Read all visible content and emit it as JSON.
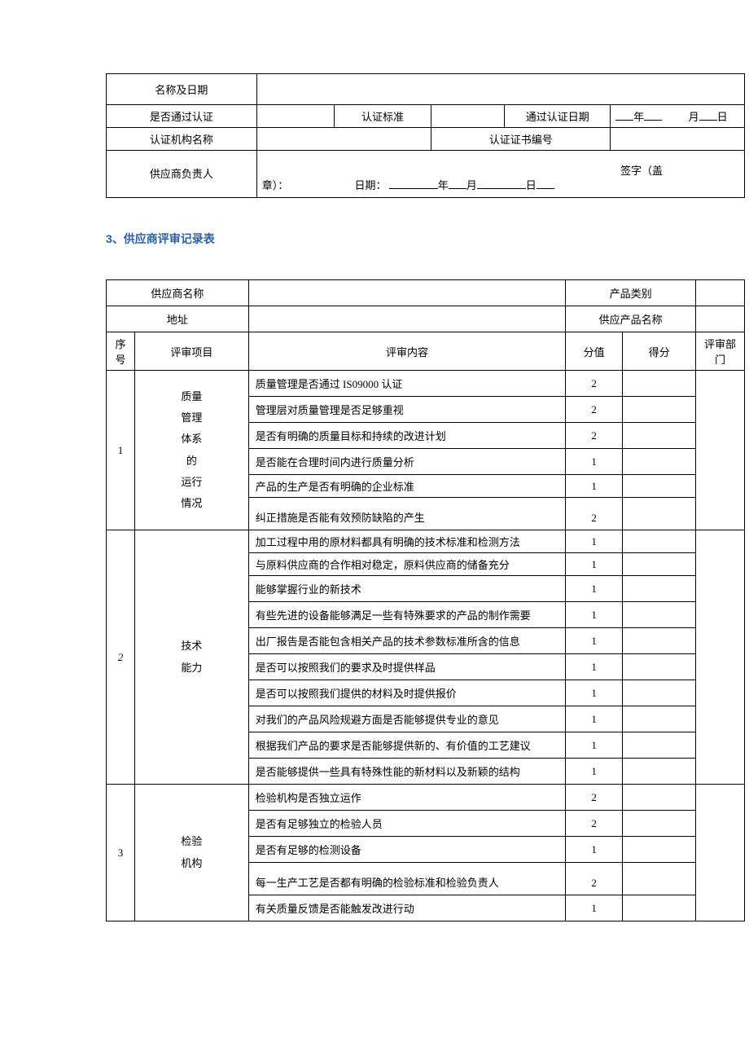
{
  "top": {
    "row1_label": "名称及日期",
    "cert_pass": "是否通过认证",
    "cert_std": "认证标准",
    "cert_date_label": "通过认证日期",
    "cert_date_y": "年",
    "cert_date_m": "月",
    "cert_date_d": "日",
    "cert_org": "认证机构名称",
    "cert_no": "认证证书编号",
    "supplier_mgr": "供应商负责人",
    "sig_label": "签字（盖",
    "sig_tail": "章）：",
    "date_label": "日期：",
    "y": "年",
    "m": "月",
    "d": "日"
  },
  "section_title_num": "3",
  "section_title_text": "、供应商评审记录表",
  "main": {
    "supplier_name_label": "供应商名称",
    "product_cat": "产品类别",
    "addr": "地址",
    "supply_product": "供应产品名称",
    "seq": "序号",
    "review_item": "评审项目",
    "review_content": "评审内容",
    "score_val": "分值",
    "score": "得分",
    "dept": "评审部门",
    "groups": [
      {
        "seq": "1",
        "item_lines": [
          "质量",
          "管理",
          "体系",
          "的",
          "运行",
          "情况"
        ],
        "rows": [
          {
            "c": "质量管理是否通过 IS09000 认证",
            "v": "2"
          },
          {
            "c": "管理层对质量管理是否足够重视",
            "v": "2"
          },
          {
            "c": "是否有明确的质量目标和持续的改进计划",
            "v": "2"
          },
          {
            "c": "是否能在合理时间内进行质量分析",
            "v": "1"
          },
          {
            "c": "产品的生产是否有明确的企业标准",
            "v": "1"
          },
          {
            "c": "纠正措施是否能有效预防缺陷的产生",
            "v": "2"
          }
        ]
      },
      {
        "seq": "2",
        "item_lines": [
          "技术",
          "能力"
        ],
        "rows": [
          {
            "c": "加工过程中用的原材料都具有明确的技术标准和检测方法",
            "v": "1"
          },
          {
            "c": "与原料供应商的合作相对稳定，原料供应商的储备充分",
            "v": "1"
          },
          {
            "c": "能够掌握行业的新技术",
            "v": "1"
          },
          {
            "c": "有些先进的设备能够满足一些有特殊要求的产品的制作需要",
            "v": "1"
          },
          {
            "c": "出厂报告是否能包含相关产品的技术参数标准所含的信息",
            "v": "1"
          },
          {
            "c": "是否可以按照我们的要求及时提供样品",
            "v": "1"
          },
          {
            "c": "是否可以按照我们提供的材料及时提供报价",
            "v": "1"
          },
          {
            "c": "对我们的产品风险规避方面是否能够提供专业的意见",
            "v": "1"
          },
          {
            "c": "根据我们产品的要求是否能够提供新的、有价值的工艺建议",
            "v": "1"
          },
          {
            "c": "是否能够提供一些具有特殊性能的新材料以及新颖的结构",
            "v": "1"
          }
        ]
      },
      {
        "seq": "3",
        "item_lines": [
          "检验",
          "机构"
        ],
        "rows": [
          {
            "c": "检验机构是否独立运作",
            "v": "2"
          },
          {
            "c": "是否有足够独立的检验人员",
            "v": "2"
          },
          {
            "c": "是否有足够的检测设备",
            "v": "1"
          },
          {
            "c": "每一生产工艺是否都有明确的检验标准和检验负责人",
            "v": "2"
          },
          {
            "c": "有关质量反馈是否能触发改进行动",
            "v": "1"
          }
        ]
      }
    ]
  }
}
